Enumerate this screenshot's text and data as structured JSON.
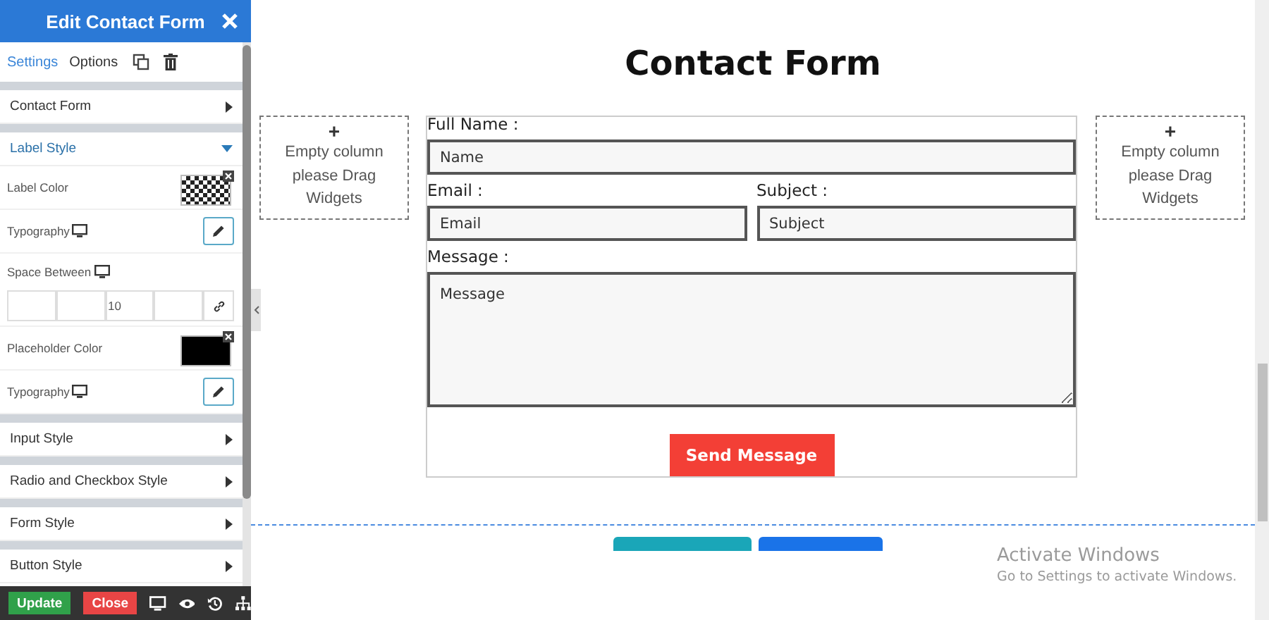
{
  "panel": {
    "title": "Edit Contact Form",
    "tabs": [
      {
        "label": "Settings",
        "selected": true
      },
      {
        "label": "Options",
        "selected": false
      }
    ],
    "sections": [
      {
        "title": "Contact Form",
        "expanded": false
      },
      {
        "title": "Label Style",
        "expanded": true,
        "controls": [
          {
            "kind": "color",
            "label": "Label Color",
            "transparent": true
          },
          {
            "kind": "typography",
            "label": "Typography",
            "responsive": true
          },
          {
            "kind": "spacing",
            "label": "Space Between",
            "responsive": true,
            "boxes": [
              {
                "filled": false
              },
              {
                "filled": false
              },
              {
                "filled": true,
                "value": "10"
              },
              {
                "filled": false
              }
            ]
          },
          {
            "kind": "color",
            "label": "Placeholder Color",
            "transparent": false,
            "color": "#000000"
          },
          {
            "kind": "typography",
            "label": "Typography",
            "responsive": true
          }
        ]
      },
      {
        "title": "Input Style",
        "expanded": false
      },
      {
        "title": "Radio and Checkbox Style",
        "expanded": false
      },
      {
        "title": "Form Style",
        "expanded": false
      },
      {
        "title": "Button Style",
        "expanded": false
      }
    ],
    "footer": {
      "buttons": [
        {
          "label": "Update",
          "kind": "primary"
        },
        {
          "label": "Close",
          "kind": "danger"
        }
      ]
    }
  },
  "canvas": {
    "title": "Contact Form",
    "empty_columns": [
      {
        "plus": "+",
        "text": "Empty column please Drag Widgets"
      },
      {
        "plus": "+",
        "text": "Empty column please Drag Widgets"
      }
    ],
    "form": {
      "rows": [
        [
          {
            "label": "Full Name :",
            "placeholder": "Name",
            "kind": "input"
          }
        ],
        [
          {
            "label": "Email :",
            "placeholder": "Email",
            "kind": "input"
          },
          {
            "label": "Subject :",
            "placeholder": "Subject",
            "kind": "input"
          }
        ],
        [
          {
            "label": "Message :",
            "placeholder": "Message",
            "kind": "textarea"
          }
        ]
      ],
      "submit": "Send Message"
    }
  },
  "overlay": {
    "title": "Activate Windows",
    "subtitle": "Go to Settings to activate Windows."
  }
}
